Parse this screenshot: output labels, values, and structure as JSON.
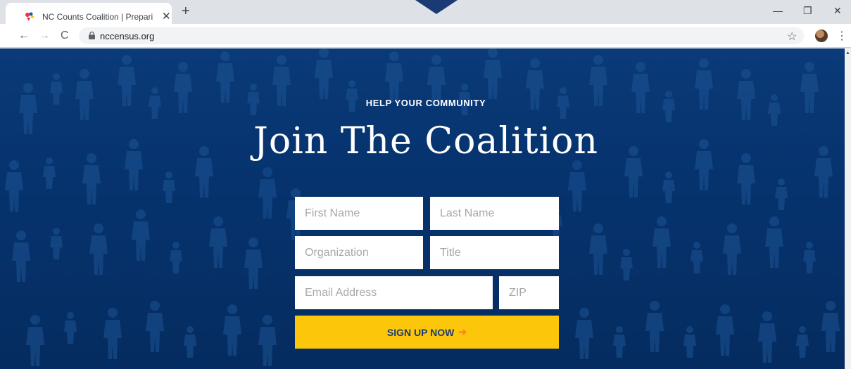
{
  "browser": {
    "tab_title": "NC Counts Coalition | Preparing f",
    "close_glyph": "✕",
    "newtab_glyph": "+",
    "url": "nccensus.org",
    "back_glyph": "←",
    "forward_glyph": "→",
    "reload_glyph": "C",
    "star_glyph": "☆",
    "menu_glyph": "⋮",
    "minimize_glyph": "—",
    "maximize_glyph": "❐",
    "window_close_glyph": "✕",
    "scroll_up_glyph": "▲"
  },
  "hero": {
    "eyebrow": "HELP YOUR COMMUNITY",
    "headline": "Join The Coalition"
  },
  "form": {
    "first_name_placeholder": "First Name",
    "last_name_placeholder": "Last Name",
    "organization_placeholder": "Organization",
    "title_placeholder": "Title",
    "email_placeholder": "Email Address",
    "zip_placeholder": "ZIP",
    "submit_label": "SIGN UP NOW",
    "submit_arrow": "➔"
  },
  "colors": {
    "hero_blue": "#06336e",
    "button_yellow": "#fcc70a",
    "button_text": "#1a3a73",
    "arrow_orange": "#f08a1e"
  },
  "icons": [
    "nccounts-favicon",
    "lock-icon",
    "star-icon",
    "avatar",
    "menu-icon",
    "back-icon",
    "forward-icon",
    "reload-icon",
    "arrow-right-icon"
  ]
}
